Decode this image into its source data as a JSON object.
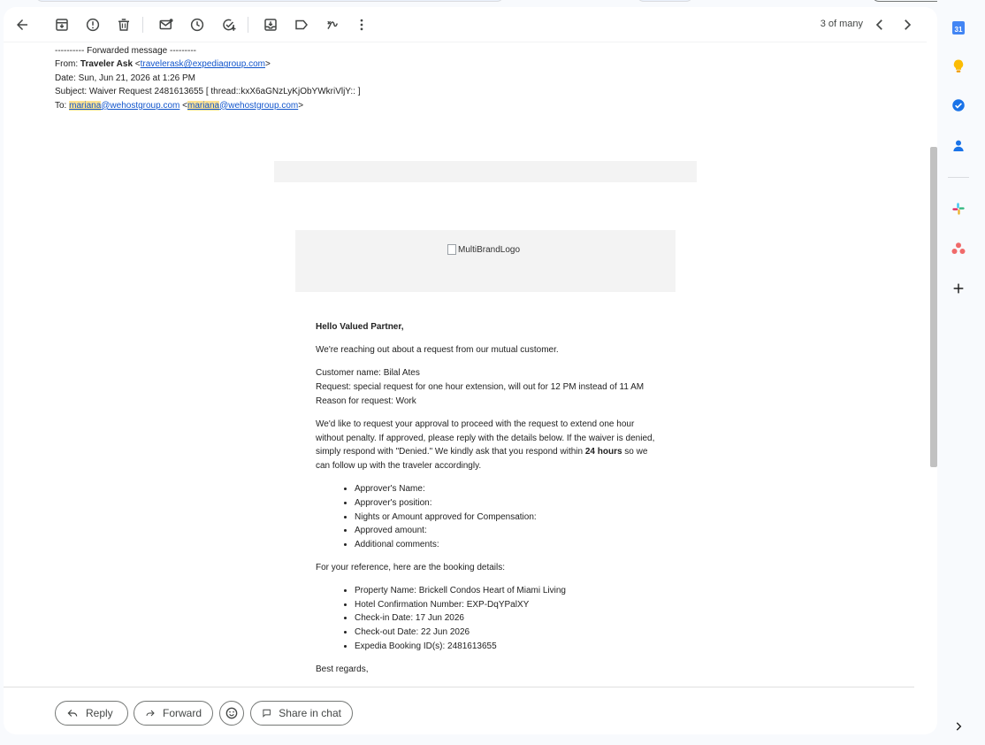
{
  "toolbar": {
    "back_icon": "arrow-left-icon",
    "buttons": [
      "archive-icon",
      "report-spam-icon",
      "delete-icon",
      "mark-unread-icon",
      "snooze-icon",
      "add-task-icon",
      "move-to-icon",
      "label-icon",
      "more-actions-icon"
    ],
    "pager": "3 of many"
  },
  "forwarded": {
    "header": "---------- Forwarded message ---------",
    "from_label": "From:",
    "from_name": "Traveler Ask",
    "from_email": "travelerask@expediagroup.com",
    "date": "Date: Sun, Jun 21, 2026 at 1:26 PM",
    "subject": "Subject: Waiver Request 2481613655 [ thread::kxX6aGNzLyKjObYWkriVljY:: ]",
    "to_label": "To:",
    "to_user": "mariana",
    "to_domain": "@wehostgroup.com"
  },
  "logo_alt": "MultiBrandLogo",
  "letter": {
    "greeting": "Hello Valued Partner,",
    "intro": "We're reaching out about a request from our mutual customer.",
    "customer": "Customer name: Bilal Ates",
    "request": "Request: special request for one hour extension, will out for 12 PM instead of 11 AM",
    "reason": "Reason for request: Work",
    "body_pre": "We'd like to request your approval to proceed with the request to extend one hour without penalty. If approved, please reply with the details below. If the waiver is denied, simply respond with \"Denied.\" We kindly ask that you respond within ",
    "body_bold": "24 hours",
    "body_post": " so we can follow up with the traveler accordingly.",
    "approval_items": [
      "Approver's Name:",
      "Approver's position:",
      "Nights or Amount approved for Compensation:",
      "Approved amount:",
      "Additional comments:"
    ],
    "reference_intro": "For your reference, here are the booking details:",
    "booking_items": [
      "Property Name: Brickell Condos Heart of Miami Living",
      "Hotel Confirmation Number: EXP-DqYPalXY",
      "Check-in Date: 17 Jun 2026",
      "Check-out Date: 22 Jun 2026",
      "Expedia Booking ID(s): 2481613655"
    ],
    "closing": "Best regards,"
  },
  "actions": {
    "reply": "Reply",
    "forward": "Forward",
    "share": "Share in chat",
    "emoji_icon": "emoji-icon"
  },
  "side_panel": {
    "calendar_day": "31",
    "icons": [
      "calendar-icon",
      "keep-icon",
      "tasks-icon",
      "contacts-icon",
      "slack-icon",
      "asana-icon",
      "add-addon-icon",
      "expand-panel-icon"
    ]
  },
  "colors": {
    "highlight": "#fde293",
    "link": "#1155cc",
    "accent_green": "#0b8043"
  }
}
